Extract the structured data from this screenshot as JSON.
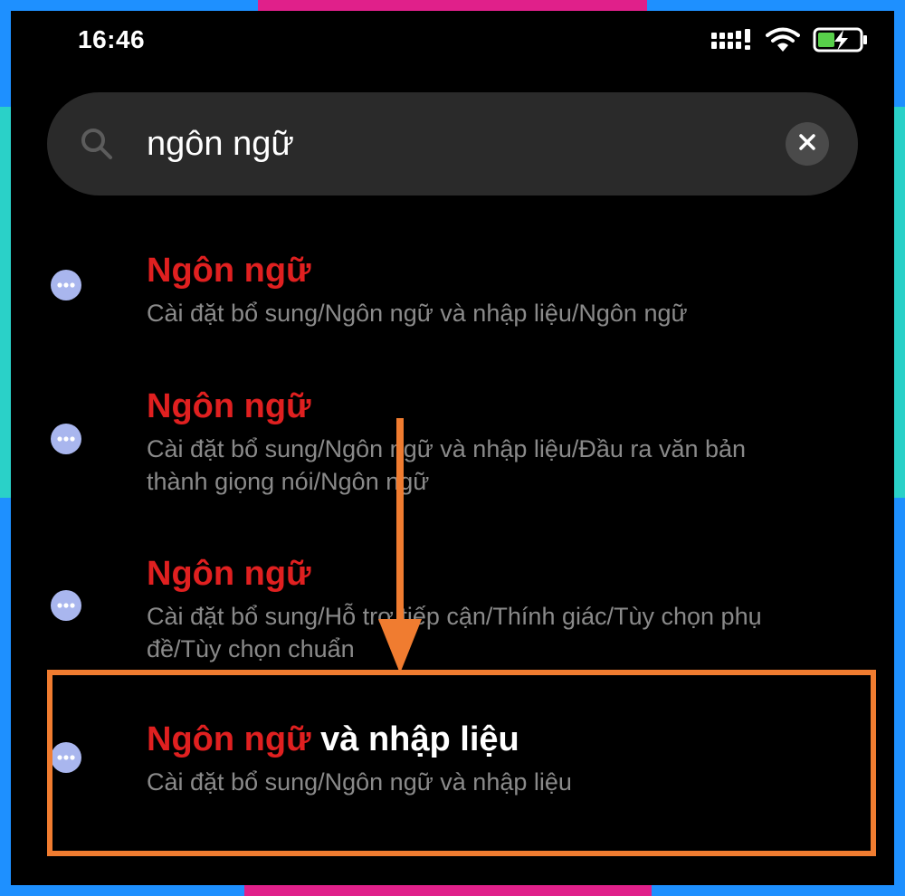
{
  "status_bar": {
    "time": "16:46",
    "signal_icon": "signal-icon",
    "wifi_icon": "wifi-icon",
    "battery_icon": "battery-charging-icon"
  },
  "search": {
    "value": "ngôn ngữ",
    "search_icon": "search-icon",
    "clear_icon": "close-icon"
  },
  "results": [
    {
      "title_highlight": "Ngôn ngữ",
      "title_rest": "",
      "path_lines": [
        "Cài đặt bổ sung/Ngôn ngữ và nhập liệu/Ngôn ngữ"
      ],
      "icon": "more-dots-icon"
    },
    {
      "title_highlight": "Ngôn ngữ",
      "title_rest": "",
      "path_lines": [
        "Cài đặt bổ sung/Ngôn ngữ và nhập liệu/Đầu ra văn bản",
        "thành giọng nói/Ngôn ngữ"
      ],
      "icon": "more-dots-icon"
    },
    {
      "title_highlight": "Ngôn ngữ",
      "title_rest": "",
      "path_lines": [
        "Cài đặt bổ sung/Hỗ trợ tiếp cận/Thính giác/Tùy chọn phụ",
        "đề/Tùy chọn chuẩn"
      ],
      "icon": "more-dots-icon"
    },
    {
      "title_highlight": "Ngôn ngữ",
      "title_rest": " và nhập liệu",
      "path_lines": [
        "Cài đặt bổ sung/Ngôn ngữ và nhập liệu"
      ],
      "icon": "more-dots-icon"
    }
  ],
  "colors": {
    "highlight_text": "#e02020",
    "annotation": "#f07c30",
    "result_icon": "#a9b6ee",
    "frame_blue": "#1e90ff",
    "frame_pink": "#e0208a",
    "frame_teal": "#2ad1c8"
  }
}
